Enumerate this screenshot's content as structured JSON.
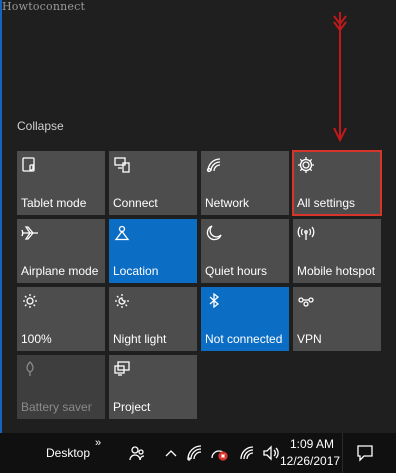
{
  "watermark": "Howtoconnect",
  "action_center": {
    "collapse_label": "Collapse",
    "tiles": [
      {
        "label": "Tablet mode",
        "icon": "tablet-mode-icon",
        "state": "off"
      },
      {
        "label": "Connect",
        "icon": "connect-icon",
        "state": "off"
      },
      {
        "label": "Network",
        "icon": "network-icon",
        "state": "off"
      },
      {
        "label": "All settings",
        "icon": "settings-gear-icon",
        "state": "off",
        "highlighted": true
      },
      {
        "label": "Airplane mode",
        "icon": "airplane-icon",
        "state": "off"
      },
      {
        "label": "Location",
        "icon": "location-icon",
        "state": "on"
      },
      {
        "label": "Quiet hours",
        "icon": "moon-icon",
        "state": "off"
      },
      {
        "label": "Mobile hotspot",
        "icon": "hotspot-icon",
        "state": "off"
      },
      {
        "label": "100%",
        "icon": "brightness-icon",
        "state": "off"
      },
      {
        "label": "Night light",
        "icon": "night-light-icon",
        "state": "off"
      },
      {
        "label": "Not connected",
        "icon": "bluetooth-icon",
        "state": "on"
      },
      {
        "label": "VPN",
        "icon": "vpn-icon",
        "state": "off"
      },
      {
        "label": "Battery saver",
        "icon": "battery-saver-icon",
        "state": "disabled"
      },
      {
        "label": "Project",
        "icon": "project-icon",
        "state": "off"
      }
    ]
  },
  "taskbar": {
    "desktop_label": "Desktop",
    "chevron": "»",
    "time": "1:09 AM",
    "date": "12/26/2017"
  },
  "colors": {
    "tile_off": "#4d4d4d",
    "tile_on": "#0b6ec4",
    "highlight": "#d6362a",
    "annotation_arrow": "#c0191b"
  }
}
